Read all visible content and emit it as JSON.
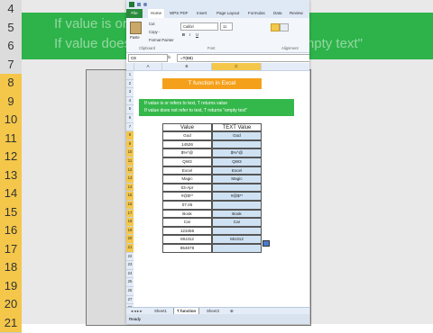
{
  "background": {
    "line1": "If value is or refers to text, T returns value",
    "line2": "If value does not refer to text, T returns \"empty text\"",
    "row_numbers": [
      "4",
      "5",
      "6",
      "7",
      "8",
      "9",
      "10",
      "11",
      "12",
      "13",
      "14",
      "15",
      "16",
      "17",
      "18",
      "19",
      "20",
      "21"
    ]
  },
  "ribbon": {
    "file_tab": "File",
    "tabs": [
      "Home",
      "WPS PDF",
      "Insert",
      "Page Layout",
      "Formulas",
      "Data",
      "Review"
    ],
    "paste": "Paste",
    "cut": "Cut",
    "copy": "Copy -",
    "format_painter": "Format Painter",
    "clipboard": "Clipboard",
    "font_name": "Calibri",
    "font_size": "11",
    "font_group": "Font",
    "alignment_group": "Alignment"
  },
  "formula_bar": {
    "name_box": "C8",
    "fx": "fx",
    "formula": "=T(B8)"
  },
  "columns": [
    "A",
    "B",
    "C"
  ],
  "rows": [
    "1",
    "2",
    "3",
    "4",
    "5",
    "6",
    "7",
    "8",
    "9",
    "10",
    "11",
    "12",
    "13",
    "14",
    "15",
    "16",
    "17",
    "18",
    "19",
    "20",
    "21",
    "22",
    "23",
    "24",
    "25",
    "26",
    "27",
    "28"
  ],
  "title": "T function in Excel",
  "info_line1": "If value is or refers to text, T returns value",
  "info_line2": "If value does not refer to text, T returns \"empty text\"",
  "table": {
    "header_value": "Value",
    "header_text": "TEXT Value",
    "values": [
      "God",
      "14526",
      "$%^@",
      "QW3",
      "Excel",
      "Magic",
      "03-Apr",
      "#@$**",
      "07:45",
      "Book",
      "Car",
      "123456",
      "MU312",
      "854678"
    ],
    "text_values": [
      "God",
      "",
      "$%^@",
      "QW3",
      "Excel",
      "Magic",
      "",
      "#@$**",
      "",
      "Book",
      "Car",
      "",
      "MU312",
      ""
    ]
  },
  "sheets": [
    "Sheet1",
    "T function",
    "Sheet3"
  ],
  "status": "Ready"
}
